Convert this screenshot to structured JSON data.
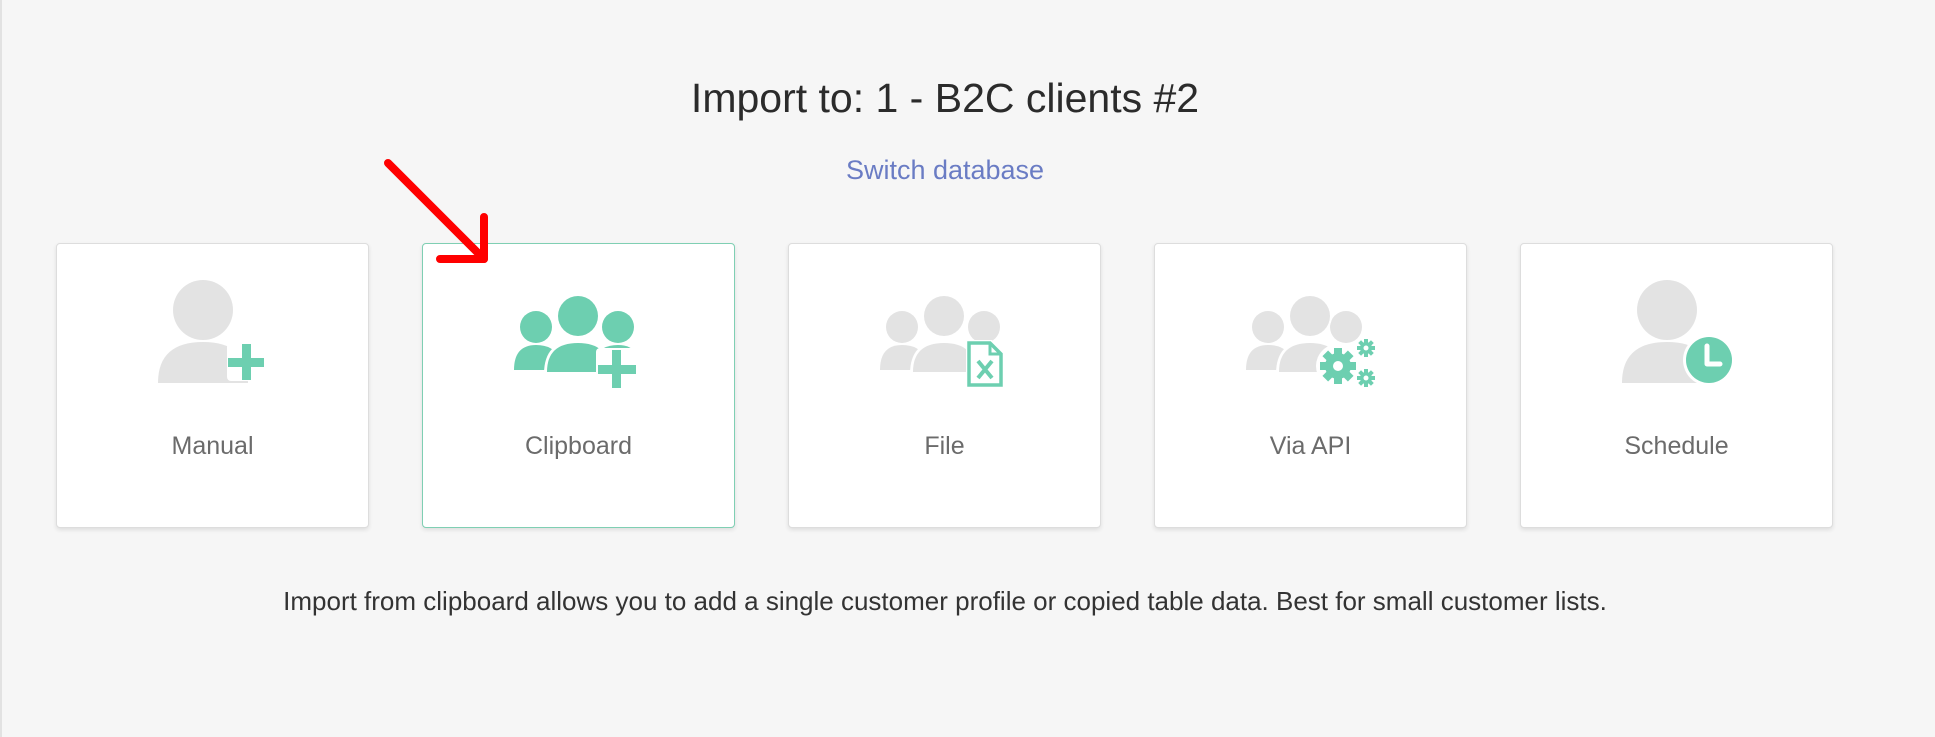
{
  "header": {
    "title": "Import to: 1 - B2C clients #2",
    "switch_link": "Switch database"
  },
  "options": [
    {
      "label": "Manual",
      "icon": "person-add-icon",
      "selected": false
    },
    {
      "label": "Clipboard",
      "icon": "group-add-icon",
      "selected": true
    },
    {
      "label": "File",
      "icon": "group-excel-file-icon",
      "selected": false
    },
    {
      "label": "Via API",
      "icon": "group-gears-icon",
      "selected": false
    },
    {
      "label": "Schedule",
      "icon": "person-clock-icon",
      "selected": false
    }
  ],
  "description": "Import from clipboard allows you to add a single customer profile or copied table data. Best for small customer lists.",
  "colors": {
    "accent": "#6dcfb0",
    "link": "#6a7cc4",
    "icon_gray": "#e3e3e3",
    "annotation_arrow": "#ff0000"
  }
}
